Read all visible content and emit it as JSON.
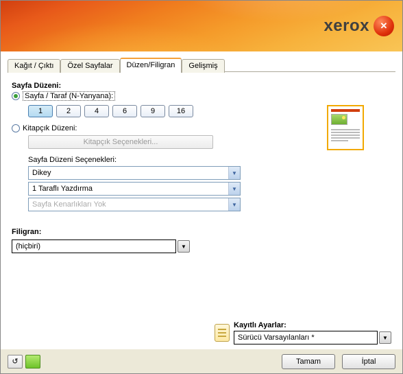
{
  "brand": "xerox",
  "tabs": [
    "Kağıt / Çıktı",
    "Özel Sayfalar",
    "Düzen/Filigran",
    "Gelişmiş"
  ],
  "active_tab": 2,
  "layout": {
    "section_title": "Sayfa Düzeni:",
    "radio_nup_label": "Sayfa / Taraf (N-Yanyana):",
    "nup_values": [
      "1",
      "2",
      "4",
      "6",
      "9",
      "16"
    ],
    "nup_selected": 0,
    "radio_booklet_label": "Kitapçık Düzeni:",
    "booklet_button": "Kitapçık Seçenekleri...",
    "options_label": "Sayfa Düzeni Seçenekleri:",
    "orientation": "Dikey",
    "sides": "1 Taraflı Yazdırma",
    "borders": "Sayfa Kenarlıkları Yok"
  },
  "watermark": {
    "label": "Filigran:",
    "value": "(hiçbiri)"
  },
  "saved": {
    "label": "Kayıtlı Ayarlar:",
    "value": "Sürücü Varsayılanları *"
  },
  "buttons": {
    "ok": "Tamam",
    "cancel": "İptal"
  }
}
